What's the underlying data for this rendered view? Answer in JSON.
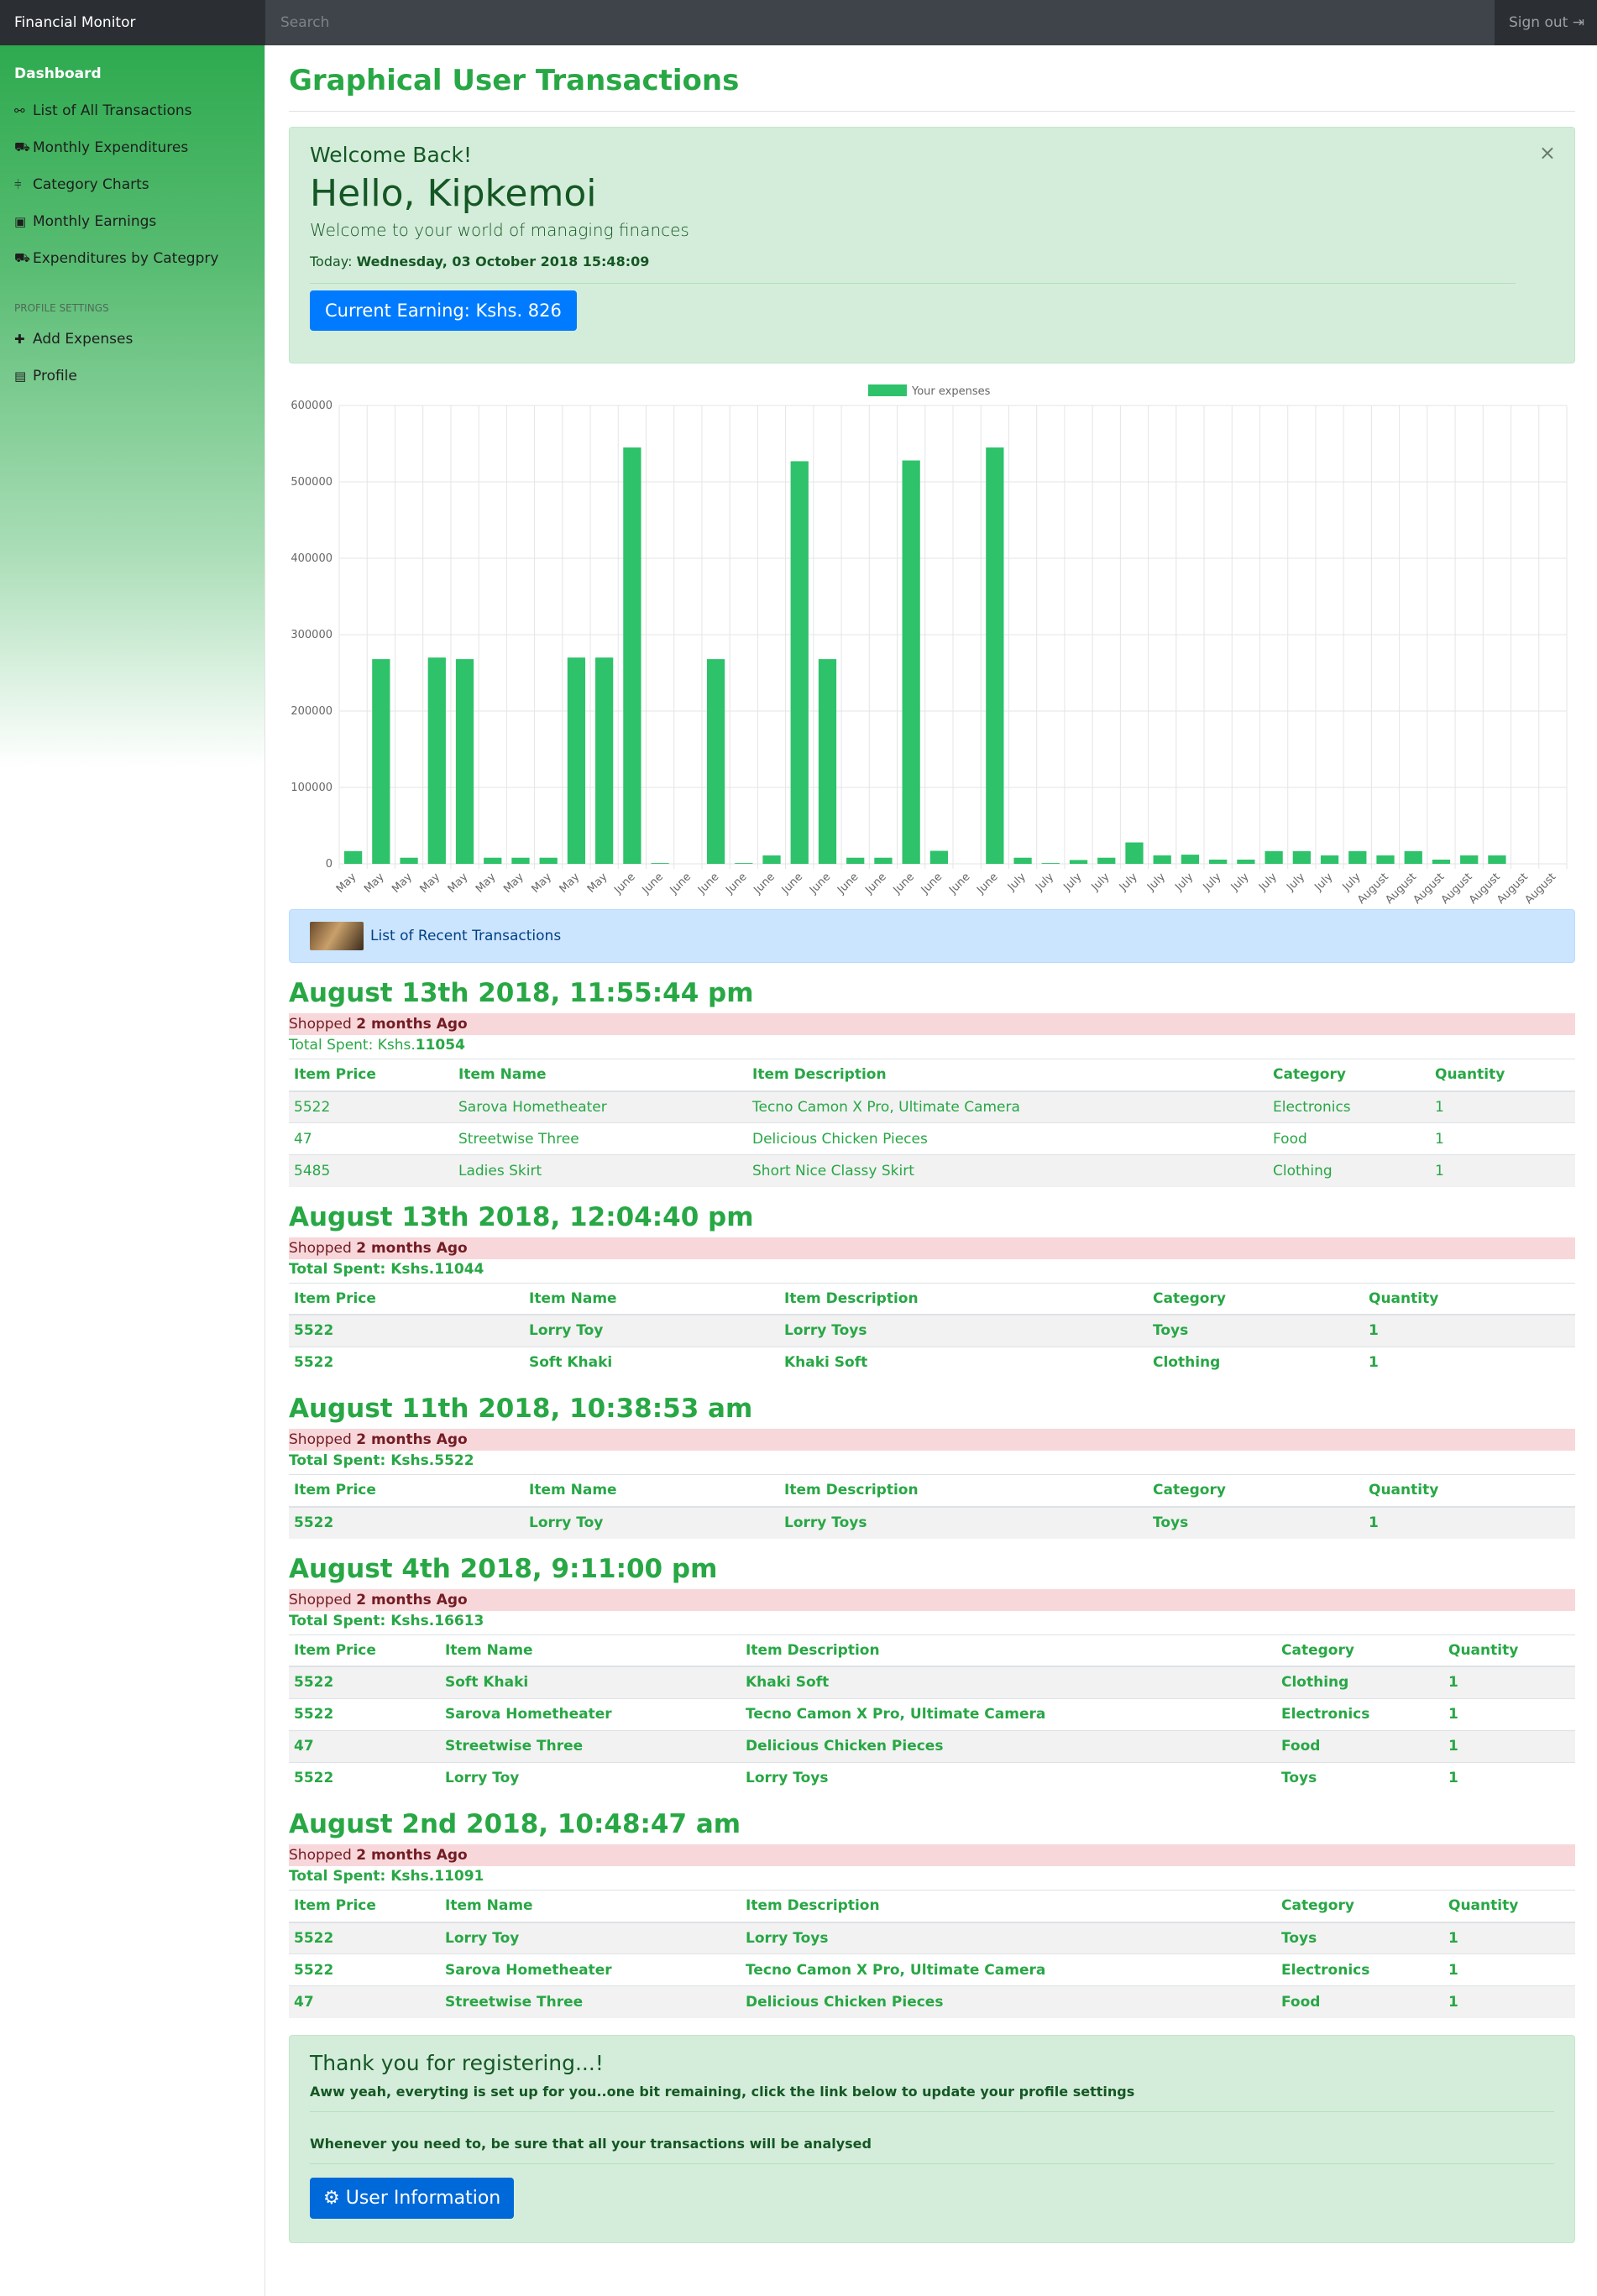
{
  "topbar": {
    "brand": "Financial Monitor",
    "search_placeholder": "Search",
    "signout": "Sign out"
  },
  "sidebar": {
    "items": [
      {
        "label": "Dashboard",
        "icon": ""
      },
      {
        "label": "List of All Transactions",
        "icon": "binoculars-icon"
      },
      {
        "label": "Monthly Expenditures",
        "icon": "basket-icon"
      },
      {
        "label": "Category Charts",
        "icon": "line-chart-icon"
      },
      {
        "label": "Monthly Earnings",
        "icon": "money-icon"
      },
      {
        "label": "Expenditures by Categpry",
        "icon": "basket-icon"
      }
    ],
    "section_title": "PROFILE SETTINGS",
    "profile_items": [
      {
        "label": "Add Expenses",
        "icon": "plus-icon"
      },
      {
        "label": "Profile",
        "icon": "id-card-icon"
      }
    ]
  },
  "page": {
    "title": "Graphical User Transactions"
  },
  "welcome": {
    "heading": "Welcome Back!",
    "greeting": "Hello, Kipkemoi",
    "lead": "Welcome to your world of managing finances",
    "today_label": "Today: ",
    "today_value": "Wednesday, 03 October 2018 15:48:09",
    "earning_button": "Current Earning: Kshs. 826",
    "close": "×"
  },
  "chart_data": {
    "type": "bar",
    "legend": "Your expenses",
    "legend_position": "top",
    "ylim": [
      0,
      600000
    ],
    "y_ticks": [
      0,
      100000,
      200000,
      300000,
      400000,
      500000,
      600000
    ],
    "grid": true,
    "bar_color": "#2ec26a",
    "categories": [
      "May",
      "May",
      "May",
      "May",
      "May",
      "May",
      "May",
      "May",
      "May",
      "May",
      "June",
      "June",
      "June",
      "June",
      "June",
      "June",
      "June",
      "June",
      "June",
      "June",
      "June",
      "June",
      "June",
      "June",
      "July",
      "July",
      "July",
      "July",
      "July",
      "July",
      "July",
      "July",
      "July",
      "July",
      "July",
      "July",
      "July",
      "August",
      "August",
      "August",
      "August",
      "August",
      "August",
      "August"
    ],
    "values": [
      16613,
      268000,
      8000,
      270000,
      268000,
      8000,
      8000,
      8000,
      270000,
      270000,
      545000,
      1000,
      0,
      268000,
      1000,
      11000,
      527000,
      268000,
      8000,
      8000,
      528000,
      17000,
      0,
      545000,
      8000,
      1000,
      5000,
      8000,
      28000,
      11091,
      12000,
      5522,
      5522,
      16613,
      16613,
      11044,
      16613,
      11044,
      16613,
      5522,
      11054,
      11044
    ]
  },
  "recent": {
    "title": "List of Recent Transactions"
  },
  "transactions": [
    {
      "date": "August 13th 2018, 11:55:44 pm",
      "shopped_prefix": "Shopped ",
      "shopped_bold": "2 months Ago",
      "total": "Total Spent: Kshs.",
      "total_value": "11054",
      "headers": [
        "Item Price",
        "Item Name",
        "Item Description",
        "Category",
        "Quantity"
      ],
      "rows": [
        [
          "5522",
          "Sarova Hometheater",
          "Tecno Camon X Pro, Ultimate Camera",
          "Electronics",
          "1"
        ],
        [
          "47",
          "Streetwise Three",
          "Delicious Chicken Pieces",
          "Food",
          "1"
        ],
        [
          "5485",
          "Ladies Skirt",
          "Short Nice Classy Skirt",
          "Clothing",
          "1"
        ]
      ]
    },
    {
      "date": "August 13th 2018, 12:04:40 pm",
      "shopped_prefix": "Shopped ",
      "shopped_bold": "2 months Ago",
      "total": "Total Spent: Kshs.",
      "total_value": "11044",
      "headers": [
        "Item Price",
        "Item Name",
        "Item Description",
        "Category",
        "Quantity"
      ],
      "rows": [
        [
          "5522",
          "Lorry Toy",
          "Lorry Toys",
          "Toys",
          "1"
        ],
        [
          "5522",
          "Soft Khaki",
          "Khaki Soft",
          "Clothing",
          "1"
        ]
      ]
    },
    {
      "date": "August 11th 2018, 10:38:53 am",
      "shopped_prefix": "Shopped ",
      "shopped_bold": "2 months Ago",
      "total": "Total Spent: Kshs.",
      "total_value": "5522",
      "headers": [
        "Item Price",
        "Item Name",
        "Item Description",
        "Category",
        "Quantity"
      ],
      "rows": [
        [
          "5522",
          "Lorry Toy",
          "Lorry Toys",
          "Toys",
          "1"
        ]
      ]
    },
    {
      "date": "August 4th 2018, 9:11:00 pm",
      "shopped_prefix": "Shopped ",
      "shopped_bold": "2 months Ago",
      "total": "Total Spent: Kshs.",
      "total_value": "16613",
      "headers": [
        "Item Price",
        "Item Name",
        "Item Description",
        "Category",
        "Quantity"
      ],
      "rows": [
        [
          "5522",
          "Soft Khaki",
          "Khaki Soft",
          "Clothing",
          "1"
        ],
        [
          "5522",
          "Sarova Hometheater",
          "Tecno Camon X Pro, Ultimate Camera",
          "Electronics",
          "1"
        ],
        [
          "47",
          "Streetwise Three",
          "Delicious Chicken Pieces",
          "Food",
          "1"
        ],
        [
          "5522",
          "Lorry Toy",
          "Lorry Toys",
          "Toys",
          "1"
        ]
      ]
    },
    {
      "date": "August 2nd 2018, 10:48:47 am",
      "shopped_prefix": "Shopped ",
      "shopped_bold": "2 months Ago",
      "total": "Total Spent: Kshs.",
      "total_value": "11091",
      "headers": [
        "Item Price",
        "Item Name",
        "Item Description",
        "Category",
        "Quantity"
      ],
      "rows": [
        [
          "5522",
          "Lorry Toy",
          "Lorry Toys",
          "Toys",
          "1"
        ],
        [
          "5522",
          "Sarova Hometheater",
          "Tecno Camon X Pro, Ultimate Camera",
          "Electronics",
          "1"
        ],
        [
          "47",
          "Streetwise Three",
          "Delicious Chicken Pieces",
          "Food",
          "1"
        ]
      ]
    }
  ],
  "thanks": {
    "heading": "Thank you for registering...!",
    "line1": "Aww yeah, everyting is set up for you..one bit remaining, click the link below to update your profile settings",
    "line2": "Whenever you need to, be sure that all your transactions will be analysed",
    "button": "User Information"
  }
}
